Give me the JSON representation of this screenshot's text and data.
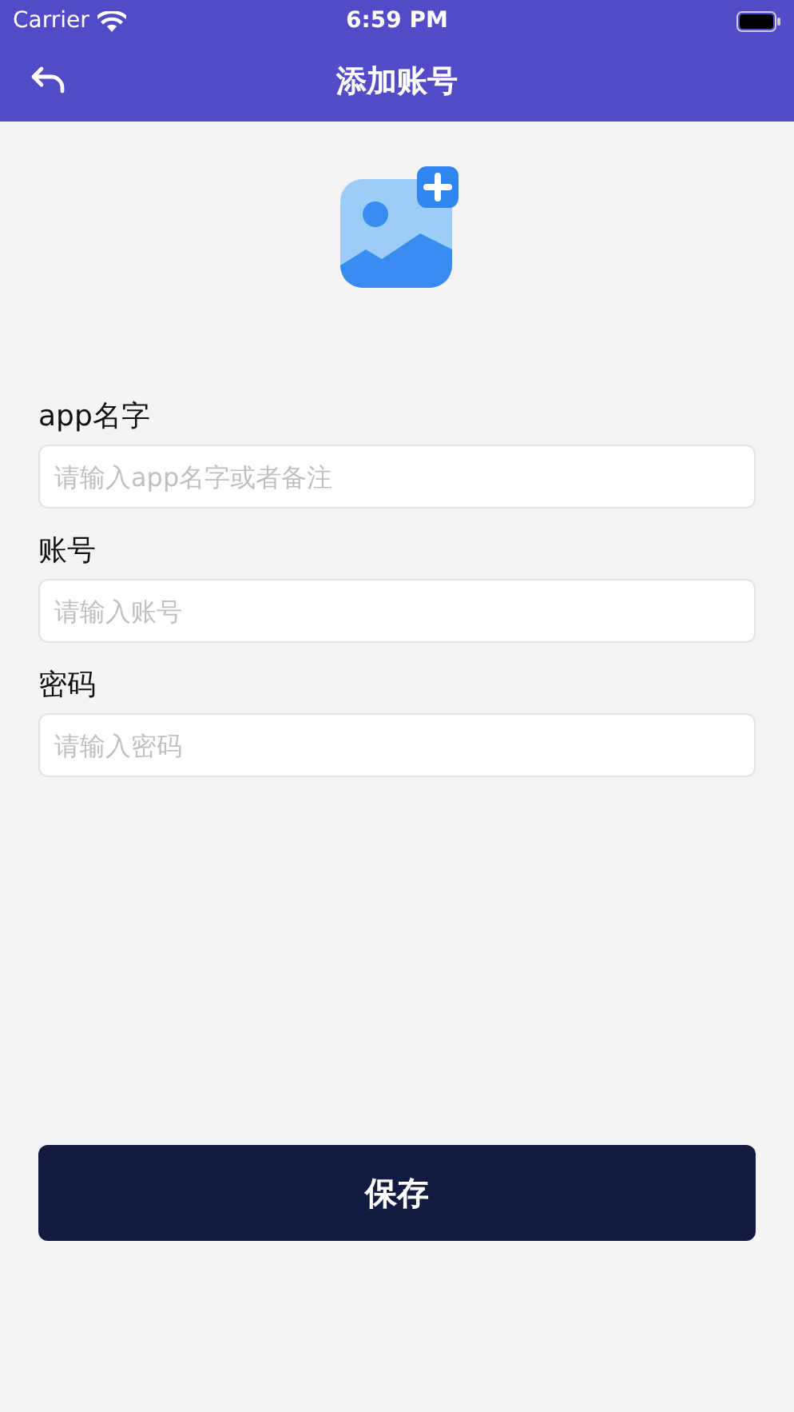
{
  "status_bar": {
    "carrier": "Carrier",
    "time": "6:59 PM"
  },
  "nav": {
    "title": "添加账号"
  },
  "fields": [
    {
      "label": "app名字",
      "placeholder": "请输入app名字或者备注"
    },
    {
      "label": "账号",
      "placeholder": "请输入账号"
    },
    {
      "label": "密码",
      "placeholder": "请输入密码"
    }
  ],
  "save_button": "保存"
}
